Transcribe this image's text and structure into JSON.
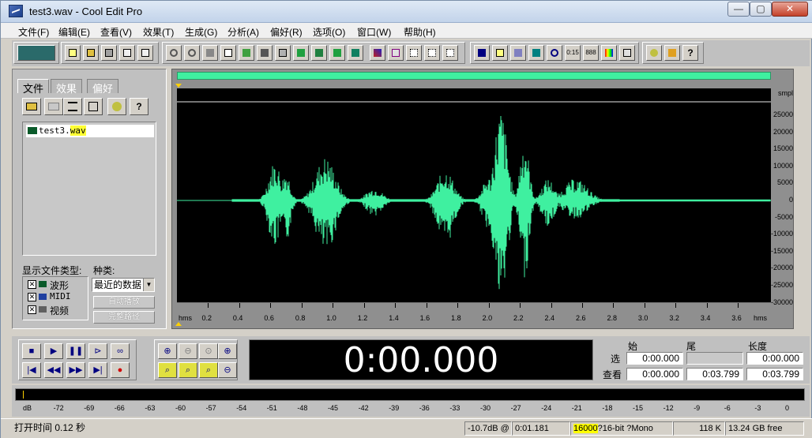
{
  "window": {
    "title": "test3.wav - Cool Edit Pro",
    "min": "—",
    "max": "▢",
    "close": "✕"
  },
  "menu": [
    "文件(F)",
    "编辑(E)",
    "查看(V)",
    "效果(T)",
    "生成(G)",
    "分析(A)",
    "偏好(R)",
    "选项(O)",
    "窗口(W)",
    "帮助(H)"
  ],
  "left_panel": {
    "tabs": [
      "文件",
      "效果",
      "偏好"
    ],
    "file_name_base": "test3.",
    "file_name_ext": "wav",
    "show_types_label": "显示文件类型:",
    "types": [
      {
        "label": "波形",
        "checked": "✕"
      },
      {
        "label": "MIDI",
        "checked": "✕"
      },
      {
        "label": "视频",
        "checked": "✕"
      }
    ],
    "kind_label": "种类:",
    "kind_value": "最近的数据",
    "autoplay": "自动播放",
    "full_path": "完整路径"
  },
  "waveform": {
    "y_unit": "smpl",
    "y_ticks": [
      "25000",
      "20000",
      "15000",
      "10000",
      "5000",
      "0",
      "-5000",
      "-10000",
      "-15000",
      "-20000",
      "-25000",
      "-30000"
    ],
    "x_unit": "hms",
    "x_ticks": [
      "0.2",
      "0.4",
      "0.6",
      "0.8",
      "1.0",
      "1.2",
      "1.4",
      "1.6",
      "1.8",
      "2.0",
      "2.2",
      "2.4",
      "2.6",
      "2.8",
      "3.0",
      "3.2",
      "3.4",
      "3.6"
    ],
    "wave_color": "#3ff0a0"
  },
  "transport": {
    "time": "0:00.000",
    "col_start": "始",
    "col_end": "尾",
    "col_length": "长度",
    "row_select": "选",
    "row_view": "查看",
    "sel_start": "0:00.000",
    "sel_end": "",
    "sel_length": "0:00.000",
    "view_start": "0:00.000",
    "view_end": "0:03.799",
    "view_length": "0:03.799"
  },
  "meter_ticks": [
    "dB",
    "-72",
    "-69",
    "-66",
    "-63",
    "-60",
    "-57",
    "-54",
    "-51",
    "-48",
    "-45",
    "-42",
    "-39",
    "-36",
    "-33",
    "-30",
    "-27",
    "-24",
    "-21",
    "-18",
    "-15",
    "-12",
    "-9",
    "-6",
    "-3",
    "0"
  ],
  "status": {
    "open_time": "打开时间 0.12 秒",
    "level": "-10.7dB @",
    "pos": "0:01.181",
    "sample_rate": "16000",
    "format": "?16-bit ?Mono",
    "size": "118 K",
    "free": "13.24 GB free"
  }
}
